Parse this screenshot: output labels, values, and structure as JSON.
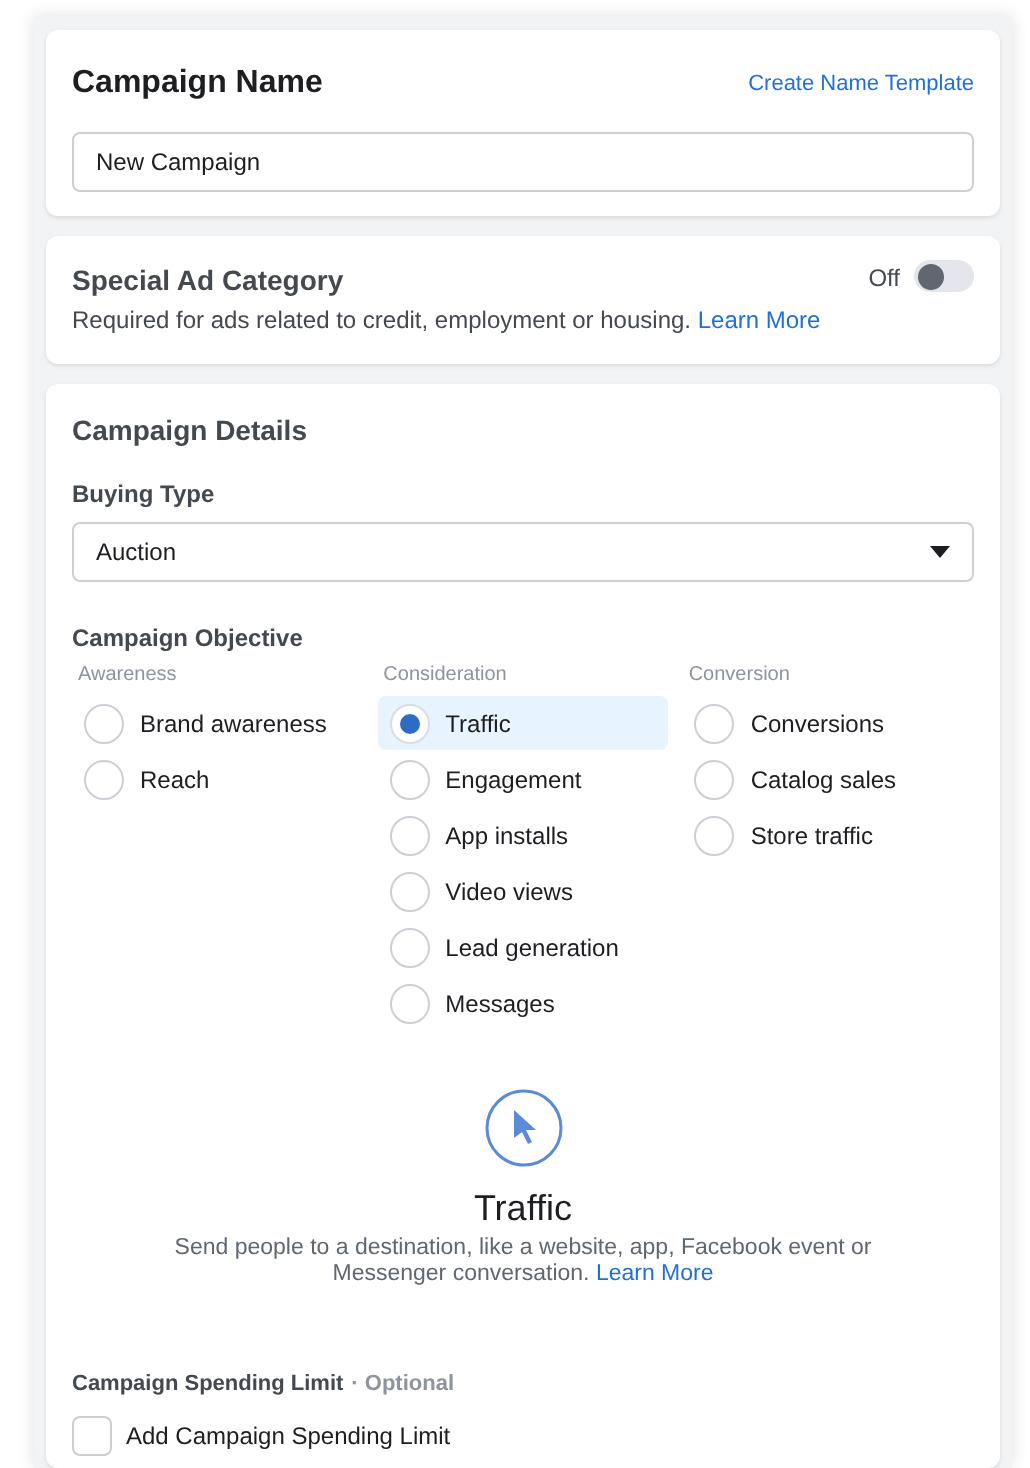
{
  "campaign_name": {
    "title": "Campaign Name",
    "template_link": "Create Name Template",
    "value": "New Campaign"
  },
  "special_ad_category": {
    "title": "Special Ad Category",
    "description": "Required for ads related to credit, employment or housing.",
    "link": "Learn More",
    "toggle_label": "Off",
    "on": false
  },
  "campaign_details": {
    "title": "Campaign Details",
    "buying_type": {
      "label": "Buying Type",
      "value": "Auction"
    },
    "objective": {
      "label": "Campaign Objective",
      "groups": [
        {
          "name": "Awareness",
          "options": [
            {
              "label": "Brand awareness",
              "selected": false
            },
            {
              "label": "Reach",
              "selected": false
            }
          ]
        },
        {
          "name": "Consideration",
          "options": [
            {
              "label": "Traffic",
              "selected": true
            },
            {
              "label": "Engagement",
              "selected": false
            },
            {
              "label": "App installs",
              "selected": false
            },
            {
              "label": "Video views",
              "selected": false
            },
            {
              "label": "Lead generation",
              "selected": false
            },
            {
              "label": "Messages",
              "selected": false
            }
          ]
        },
        {
          "name": "Conversion",
          "options": [
            {
              "label": "Conversions",
              "selected": false
            },
            {
              "label": "Catalog sales",
              "selected": false
            },
            {
              "label": "Store traffic",
              "selected": false
            }
          ]
        }
      ]
    },
    "selected_objective": {
      "title": "Traffic",
      "description": "Send people to a destination, like a website, app, Facebook event or Messenger conversation.",
      "link": "Learn More"
    },
    "spending_limit": {
      "label": "Campaign Spending Limit",
      "optional": "· Optional",
      "checkbox_label": "Add Campaign Spending Limit",
      "checked": false
    }
  }
}
